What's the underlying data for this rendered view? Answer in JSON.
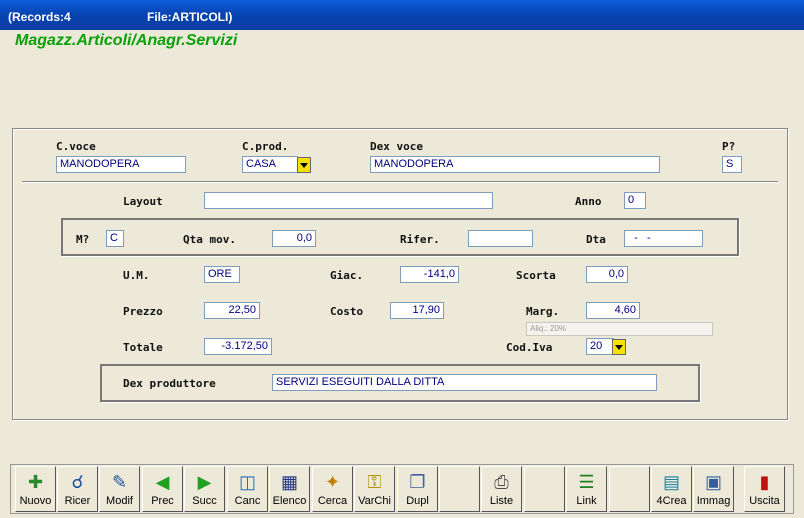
{
  "window": {
    "records": "(Records:4",
    "file": "File:ARTICOLI)"
  },
  "app_title": "Magazz.Articoli/Anagr.Servizi",
  "header": {
    "cvoce_label": "C.voce",
    "cvoce_value": "MANODOPERA",
    "cprod_label": "C.prod.",
    "cprod_value": "CASA",
    "dexvoce_label": "Dex voce",
    "dexvoce_value": "MANODOPERA",
    "p_label": "P?",
    "p_value": "S"
  },
  "details": {
    "layout_label": "Layout",
    "layout_value": "",
    "anno_label": "Anno",
    "anno_value": "0",
    "m_label": "M?",
    "m_value": "C",
    "qta_label": "Qta mov.",
    "qta_value": "0,0",
    "rifer_label": "Rifer.",
    "rifer_value": "",
    "dta_label": "Dta",
    "dta_value": "  -   -",
    "um_label": "U.M.",
    "um_value": "ORE",
    "giac_label": "Giac.",
    "giac_value": "-141,0",
    "scorta_label": "Scorta",
    "scorta_value": "0,0",
    "prezzo_label": "Prezzo",
    "prezzo_value": "22,50",
    "costo_label": "Costo",
    "costo_value": "17,90",
    "marg_label": "Marg.",
    "marg_value": "4,60",
    "aliq_value": "Aliq.: 20%",
    "totale_label": "Totale",
    "totale_value": "-3.172,50",
    "codiva_label": "Cod.Iva",
    "codiva_value": "20",
    "dexprod_label": "Dex produttore",
    "dexprod_value": "SERVIZI ESEGUITI DALLA DITTA"
  },
  "toolbar": {
    "nuovo": "Nuovo",
    "ricer": "Ricer",
    "modif": "Modif",
    "prec": "Prec",
    "succ": "Succ",
    "canc": "Canc",
    "elenco": "Elenco",
    "cerca": "Cerca",
    "varchi": "VarChi",
    "dupl": "Dupl",
    "liste": "Liste",
    "link": "Link",
    "crea": "4Crea",
    "immag": "Immag",
    "uscita": "Uscita"
  },
  "icons": {
    "nuovo": "new-document-icon",
    "ricer": "magnifier-icon",
    "modif": "edit-document-icon",
    "prec": "arrow-left-icon",
    "succ": "arrow-right-icon",
    "canc": "trash-icon",
    "elenco": "list-icon",
    "cerca": "search-icon",
    "varchi": "keys-icon",
    "dupl": "duplicate-icon",
    "liste": "printer-icon",
    "link": "tree-icon",
    "crea": "chart-icon",
    "immag": "image-icon",
    "uscita": "exit-door-icon"
  }
}
